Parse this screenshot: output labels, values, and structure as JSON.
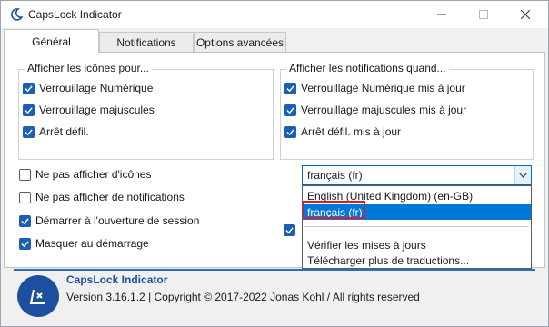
{
  "window": {
    "title": "CapsLock Indicator",
    "icon": "moon-icon",
    "controls": {
      "minimize": "minimize-icon",
      "maximize": "maximize-icon",
      "close": "close-icon"
    }
  },
  "tabs": [
    {
      "label": "Général",
      "active": true
    },
    {
      "label": "Notifications",
      "active": false
    },
    {
      "label": "Options avancées",
      "active": false
    }
  ],
  "icons_group": {
    "title": "Afficher les icônes pour...",
    "items": [
      {
        "label": "Verrouillage Numérique",
        "checked": true
      },
      {
        "label": "Verrouillage majuscules",
        "checked": true
      },
      {
        "label": "Arrêt défil.",
        "checked": true
      }
    ]
  },
  "notifications_group": {
    "title": "Afficher les notifications quand...",
    "items": [
      {
        "label": "Verrouillage Numérique mis à jour",
        "checked": true
      },
      {
        "label": "Verrouillage majuscules mis à jour",
        "checked": true
      },
      {
        "label": "Arrêt défil. mis à jour",
        "checked": true
      }
    ]
  },
  "options": [
    {
      "label": "Ne pas afficher d'icônes",
      "checked": false
    },
    {
      "label": "Ne pas afficher de notifications",
      "checked": false
    },
    {
      "label": "Démarrer à l'ouverture de session",
      "checked": true
    },
    {
      "label": "Masquer au démarrage",
      "checked": true
    }
  ],
  "language": {
    "selected": "français (fr)",
    "options": [
      "English (United Kingdom) (en-GB)",
      "français (fr)"
    ],
    "actions": [
      "Vérifier les mises à jours",
      "Télécharger plus de traductions..."
    ]
  },
  "footer": {
    "app_name": "CapsLock Indicator",
    "copyright": "Version 3.16.1.2 | Copyright © 2017-2022 Jonas Kohl / All rights reserved"
  },
  "colors": {
    "accent": "#1a5fb4",
    "selection": "#0078d7",
    "highlight_outline": "#e01b24",
    "logo_bg": "#1d4fa0"
  }
}
